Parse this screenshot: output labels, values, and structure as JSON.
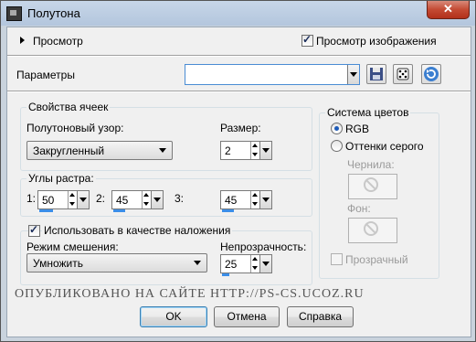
{
  "window": {
    "title": "Полутона",
    "close_label": "✕"
  },
  "preview": {
    "label": "Просмотр",
    "image_preview_label": "Просмотр изображения",
    "image_preview_checked": true
  },
  "params": {
    "label": "Параметры",
    "preset_value": ""
  },
  "cell_props": {
    "title": "Свойства ячеек",
    "pattern_label": "Полутоновый узор:",
    "pattern_value": "Закругленный",
    "size_label": "Размер:",
    "size_value": "2"
  },
  "screen_angles": {
    "title": "Углы растра:",
    "items": [
      {
        "label": "1:",
        "value": "50"
      },
      {
        "label": "2:",
        "value": "45"
      },
      {
        "label": "3:",
        "value": "45"
      }
    ]
  },
  "overlay": {
    "checkbox_label": "Использовать в качестве наложения",
    "checked": true,
    "blend_mode_label": "Режим смешения:",
    "blend_mode_value": "Умножить",
    "opacity_label": "Непрозрачность:",
    "opacity_value": "25"
  },
  "color_system": {
    "title": "Система цветов",
    "rgb_label": "RGB",
    "grayscale_label": "Оттенки серого",
    "selected": "RGB",
    "ink_label": "Чернила:",
    "background_label": "Фон:",
    "transparent_label": "Прозрачный"
  },
  "watermark": "ОПУБЛИКОВАНО НА САЙТЕ HTTP://PS-CS.UCOZ.RU",
  "buttons": {
    "ok": "OK",
    "cancel": "Отмена",
    "help": "Справка"
  }
}
